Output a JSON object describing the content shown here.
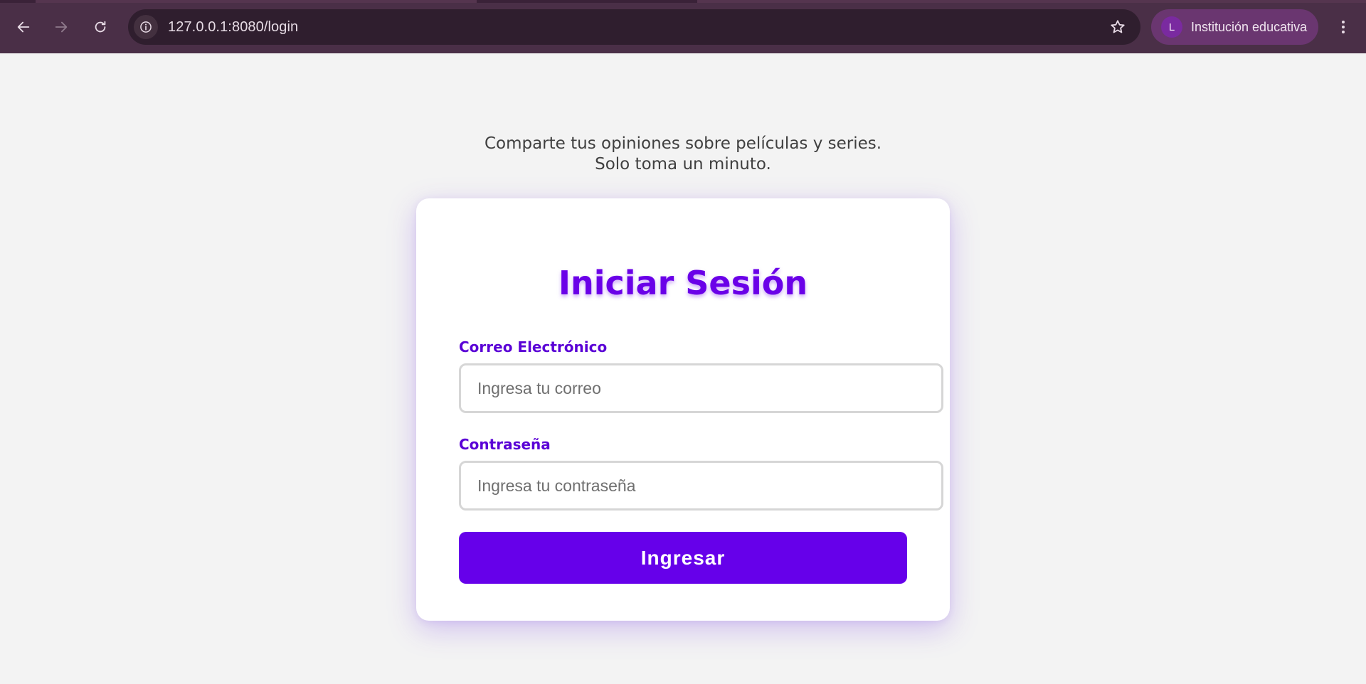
{
  "browser": {
    "url": "127.0.0.1:8080/login",
    "profile": {
      "initial": "L",
      "name": "Institución educativa"
    },
    "icons": {
      "back": "arrow-left-icon",
      "forward": "arrow-right-icon",
      "reload": "reload-icon",
      "site_info": "info-icon",
      "bookmark": "star-icon",
      "menu": "kebab-menu-icon"
    }
  },
  "page": {
    "tagline": {
      "line1": "Comparte tus opiniones sobre películas y series.",
      "line2": "Solo toma un minuto."
    },
    "login_card": {
      "title": "Iniciar Sesión",
      "email": {
        "label": "Correo Electrónico",
        "placeholder": "Ingresa tu correo",
        "value": ""
      },
      "password": {
        "label": "Contraseña",
        "placeholder": "Ingresa tu contraseña",
        "value": ""
      },
      "submit_label": "Ingresar"
    }
  },
  "colors": {
    "accent": "#6600ea",
    "label": "#5a00d6",
    "page_background": "#f3f3f3",
    "chrome_background": "#4a2f47",
    "profile_chip": "#6a3670"
  }
}
